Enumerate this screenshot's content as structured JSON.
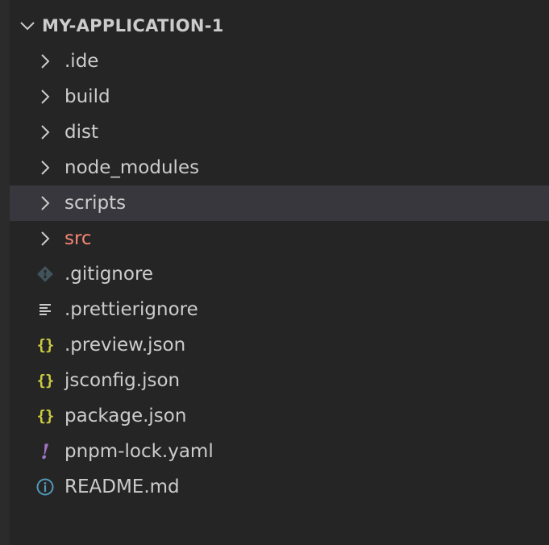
{
  "explorer": {
    "section_title": "MY-APPLICATION-1",
    "colors": {
      "background": "#252526",
      "selected_row": "#37373d",
      "text": "#cccccc",
      "modified_text": "#f48771",
      "json_icon": "#cbcb41",
      "yaml_icon": "#a074c4",
      "info_icon": "#519aba",
      "git_icon": "#41535b"
    },
    "items": [
      {
        "label": ".ide",
        "kind": "folder",
        "icon": "chevron-right-icon"
      },
      {
        "label": "build",
        "kind": "folder",
        "icon": "chevron-right-icon"
      },
      {
        "label": "dist",
        "kind": "folder",
        "icon": "chevron-right-icon"
      },
      {
        "label": "node_modules",
        "kind": "folder",
        "icon": "chevron-right-icon"
      },
      {
        "label": "scripts",
        "kind": "folder",
        "icon": "chevron-right-icon",
        "selected": true
      },
      {
        "label": "src",
        "kind": "folder",
        "icon": "chevron-right-icon",
        "modified": true
      },
      {
        "label": ".gitignore",
        "kind": "file",
        "icon": "git-icon"
      },
      {
        "label": ".prettierignore",
        "kind": "file",
        "icon": "lines-icon"
      },
      {
        "label": ".preview.json",
        "kind": "file",
        "icon": "json-icon",
        "glyph": "{}"
      },
      {
        "label": "jsconfig.json",
        "kind": "file",
        "icon": "json-icon",
        "glyph": "{}"
      },
      {
        "label": "package.json",
        "kind": "file",
        "icon": "json-icon",
        "glyph": "{}"
      },
      {
        "label": "pnpm-lock.yaml",
        "kind": "file",
        "icon": "yaml-icon",
        "glyph": "!"
      },
      {
        "label": "README.md",
        "kind": "file",
        "icon": "info-icon"
      }
    ]
  }
}
